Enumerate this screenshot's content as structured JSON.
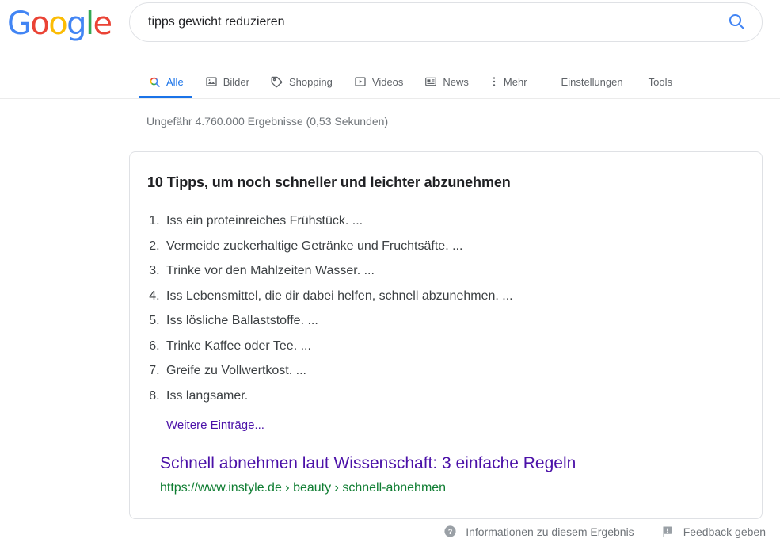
{
  "brand": {
    "name": "Google",
    "letters": [
      {
        "char": "G",
        "color": "#4285F4"
      },
      {
        "char": "o",
        "color": "#EA4335"
      },
      {
        "char": "o",
        "color": "#FBBC05"
      },
      {
        "char": "g",
        "color": "#4285F4"
      },
      {
        "char": "l",
        "color": "#34A853"
      },
      {
        "char": "e",
        "color": "#EA4335"
      }
    ]
  },
  "search": {
    "query": "tipps gewicht reduzieren",
    "placeholder": "Suche",
    "submit_icon": "search-icon",
    "submit_color": "#4285f4"
  },
  "tabs": [
    {
      "label": "Alle",
      "icon": "google-search-icon",
      "active": true
    },
    {
      "label": "Bilder",
      "icon": "image-icon",
      "active": false
    },
    {
      "label": "Shopping",
      "icon": "tag-icon",
      "active": false
    },
    {
      "label": "Videos",
      "icon": "play-box-icon",
      "active": false
    },
    {
      "label": "News",
      "icon": "newspaper-icon",
      "active": false
    },
    {
      "label": "Mehr",
      "icon": "more-vertical-icon",
      "active": false
    }
  ],
  "tools": [
    {
      "label": "Einstellungen"
    },
    {
      "label": "Tools"
    }
  ],
  "stats": {
    "text": "Ungefähr 4.760.000 Ergebnisse (0,53 Sekunden)"
  },
  "featured": {
    "title": "10 Tipps, um noch schneller und leichter abzunehmen",
    "items": [
      "Iss ein proteinreiches Frühstück. ...",
      "Vermeide zuckerhaltige Getränke und Fruchtsäfte. ...",
      "Trinke vor den Mahlzeiten Wasser. ...",
      "Iss Lebensmittel, die dir dabei helfen, schnell abzunehmen. ...",
      "Iss lösliche Ballaststoffe. ...",
      "Trinke Kaffee oder Tee. ...",
      "Greife zu Vollwertkost. ...",
      "Iss langsamer."
    ],
    "more_label": "Weitere Einträge...",
    "result_title": "Schnell abnehmen laut Wissenschaft: 3 einfache Regeln",
    "result_url": "https://www.instyle.de › beauty › schnell-abnehmen"
  },
  "footer": {
    "about": {
      "label": "Informationen zu diesem Ergebnis",
      "icon": "help-circle-icon"
    },
    "feedback": {
      "label": "Feedback geben",
      "icon": "flag-feedback-icon"
    }
  },
  "colors": {
    "link": "#4b11a8",
    "url_green": "#0f7d32",
    "accent_blue": "#1a73e8",
    "muted": "#70757a"
  }
}
